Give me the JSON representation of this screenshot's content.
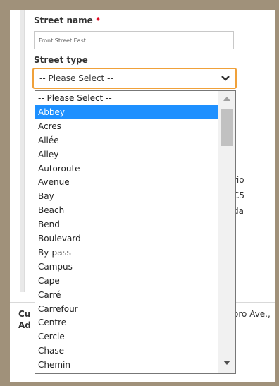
{
  "form": {
    "street_name_label": "Street name",
    "required_mark": "*",
    "street_name_value": "Front Street East",
    "street_type_label": "Street type",
    "street_type_selected": "-- Please Select --"
  },
  "background": {
    "right_fragments": [
      "rio",
      "C5",
      "da"
    ],
    "left_fragments": [
      "Cu",
      "Ad"
    ],
    "address_fragment": "oro Ave.,"
  },
  "dropdown": {
    "options": [
      "-- Please Select --",
      "Abbey",
      "Acres",
      "Allée",
      "Alley",
      "Autoroute",
      "Avenue",
      "Bay",
      "Beach",
      "Bend",
      "Boulevard",
      "By-pass",
      "Campus",
      "Cape",
      "Carré",
      "Carrefour",
      "Centre",
      "Cercle",
      "Chase",
      "Chemin"
    ],
    "highlighted_index": 1
  },
  "colors": {
    "focus_border": "#f0a13a",
    "highlight": "#1e90ff",
    "required": "#e0001b"
  }
}
